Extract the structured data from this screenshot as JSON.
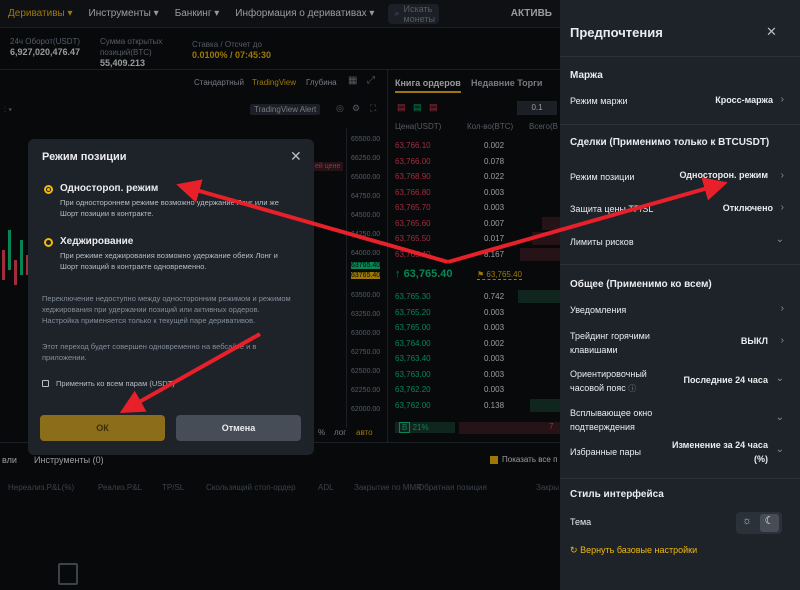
{
  "nav": {
    "items": [
      "Деривативы",
      "Инструменты",
      "Банкинг",
      "Информация о деривативах"
    ],
    "search_placeholder": "Искать монеты",
    "right_label": "АКТИВЬ"
  },
  "stats": [
    {
      "label": "24ч Оборот(USDT)",
      "value": "6,927,020,476.47"
    },
    {
      "label": "Сумма открытых позиций(BTC)",
      "value": "55,409.213"
    },
    {
      "label": "Ставка / Отсчет до",
      "value": "0.0100% / 07:45:30"
    }
  ],
  "chart": {
    "tabs": [
      "Стандартный",
      "TradingView",
      "Глубина"
    ],
    "tv_alert": "TradingView Alert",
    "price_ticks": [
      "65500.00",
      "66250.00",
      "65000.00",
      "64750.00",
      "64500.00",
      "64250.00",
      "64000.00",
      "63765.40",
      "63765.40",
      "63500.00",
      "63250.00",
      "63000.00",
      "62750.00",
      "62500.00",
      "62250.00",
      "62000.00"
    ],
    "overlay_label": "ей цене",
    "bottom_labels": [
      "%",
      "лог",
      "авто"
    ]
  },
  "orderbook": {
    "tabs": [
      "Книга ордеров",
      "Недавние Торги"
    ],
    "step": "0.1",
    "headers": [
      "Цена(USDT)",
      "Кол-во(BTC)",
      "Всего(B"
    ],
    "asks": [
      {
        "price": "63,766.10",
        "qty": "0.002"
      },
      {
        "price": "63,766.00",
        "qty": "0.078"
      },
      {
        "price": "63,768.90",
        "qty": "0.022"
      },
      {
        "price": "63,766.80",
        "qty": "0.003"
      },
      {
        "price": "63,765.70",
        "qty": "0.003"
      },
      {
        "price": "63,765.60",
        "qty": "0.007"
      },
      {
        "price": "63,765.50",
        "qty": "0.017"
      },
      {
        "price": "63,765.40",
        "qty": "8.167"
      }
    ],
    "last_price": "63,765.40",
    "mark_price": "63,765.40",
    "bids": [
      {
        "price": "63,765.30",
        "qty": "0.742"
      },
      {
        "price": "63,765.20",
        "qty": "0.003"
      },
      {
        "price": "63,765.00",
        "qty": "0.003"
      },
      {
        "price": "63,764.00",
        "qty": "0.002"
      },
      {
        "price": "63,763.40",
        "qty": "0.003"
      },
      {
        "price": "63,763.00",
        "qty": "0.003"
      },
      {
        "price": "63,762.20",
        "qty": "0.003"
      },
      {
        "price": "63,762.00",
        "qty": "0.138"
      }
    ],
    "buy_ratio": "21%",
    "sell_mark": "7"
  },
  "bottom": {
    "tabs": [
      "вли",
      "Инструменты (0)"
    ],
    "show_all": "Показать все п",
    "columns": [
      "Нереализ.P&L(%)",
      "Реализ.P&L",
      "TP/SL",
      "Скользящий стоп-ордер",
      "ADL",
      "Закрытие по MMR",
      "Обратная позиция",
      "Закры"
    ]
  },
  "modal": {
    "title": "Режим позиции",
    "option1_label": "Одностороп. режим",
    "option1_desc": "При одностороннем режиме возможно удержание Лонг или же Шорт позиции в контракте.",
    "option2_label": "Хеджирование",
    "option2_desc": "При режиме хеджирования возможно удержание обеих Лонг и Шорт позиций в контракте одновременно.",
    "note1": "Переключение недоступно между односторонним режимом и режимом хеджирования при удержании позиций или активных ордеров. Настройка применяется только к текущей паре деривативов.",
    "note2": "Этот переход будет совершен одновременно на вебсайте и в приложении.",
    "checkbox_label": "Применить ко всем парам (USDT)",
    "ok": "ОК",
    "cancel": "Отмена"
  },
  "panel": {
    "title": "Предпочтения",
    "margin_section": "Маржа",
    "margin_mode_label": "Режим маржи",
    "margin_mode_value": "Кросс-маржа",
    "trades_section": "Сделки (Применимо только к BTCUSDT)",
    "position_mode_label": "Режим позиции",
    "position_mode_value": "Односторон. режим",
    "tpsl_label": "Защита цены TP/SL",
    "tpsl_value": "Отключено",
    "risk_limits_label": "Лимиты рисков",
    "general_section": "Общее (Применимо ко всем)",
    "notifications_label": "Уведомления",
    "hotkeys_label": "Трейдинг горячими клавишами",
    "hotkeys_value": "ВЫКЛ",
    "timezone_label": "Ориентировочный часовой пояс",
    "timezone_value": "Последние 24 часа",
    "popup_label": "Всплывающее окно подтверждения",
    "favorites_label": "Избранные пары",
    "favorites_value": "Изменение за 24 часа (%)",
    "style_section": "Стиль интерфейса",
    "theme_label": "Тема",
    "reset_label": "Вернуть базовые настройки"
  },
  "colors": {
    "accent": "#f0b90b",
    "up": "#0ecb81",
    "down": "#f6465d",
    "arrow": "#e8202a"
  }
}
